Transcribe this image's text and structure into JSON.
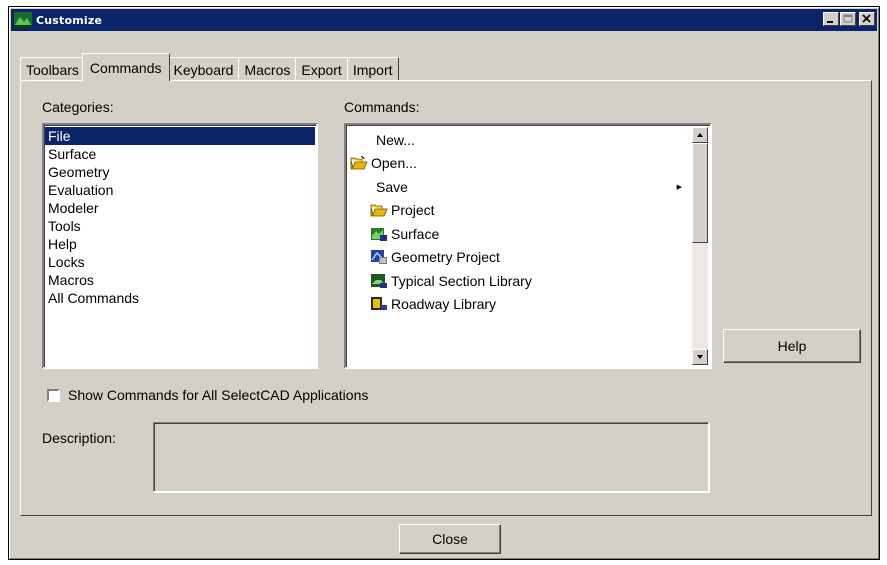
{
  "window": {
    "title": "Customize"
  },
  "tabs": [
    "Toolbars",
    "Commands",
    "Keyboard",
    "Macros",
    "Export",
    "Import"
  ],
  "active_tab": "Commands",
  "categories": {
    "label": "Categories:",
    "items": [
      "File",
      "Surface",
      "Geometry",
      "Evaluation",
      "Modeler",
      "Tools",
      "Help",
      "Locks",
      "Macros",
      "All Commands"
    ],
    "selected": "File"
  },
  "commands": {
    "label": "Commands:",
    "items": [
      {
        "label": "New...",
        "icon": "none",
        "indent": false
      },
      {
        "label": "Open...",
        "icon": "open-folder-icon",
        "indent": false
      },
      {
        "label": "Save",
        "icon": "none",
        "indent": false,
        "submenu": true
      },
      {
        "label": "Project",
        "icon": "open-folder-icon",
        "indent": true
      },
      {
        "label": "Surface",
        "icon": "surface-icon",
        "indent": true
      },
      {
        "label": "Geometry Project",
        "icon": "geometry-project-icon",
        "indent": true
      },
      {
        "label": "Typical Section Library",
        "icon": "typical-section-icon",
        "indent": true
      },
      {
        "label": "Roadway Library",
        "icon": "roadway-library-icon",
        "indent": true
      }
    ]
  },
  "help_button": "Help",
  "show_all_checkbox": {
    "label": "Show Commands for All SelectCAD Applications",
    "checked": false
  },
  "description": {
    "label": "Description:",
    "value": ""
  },
  "close_button": "Close",
  "colors": {
    "title_bar": "#0a246a",
    "selection": "#0a246a",
    "face": "#d4d0c8"
  }
}
